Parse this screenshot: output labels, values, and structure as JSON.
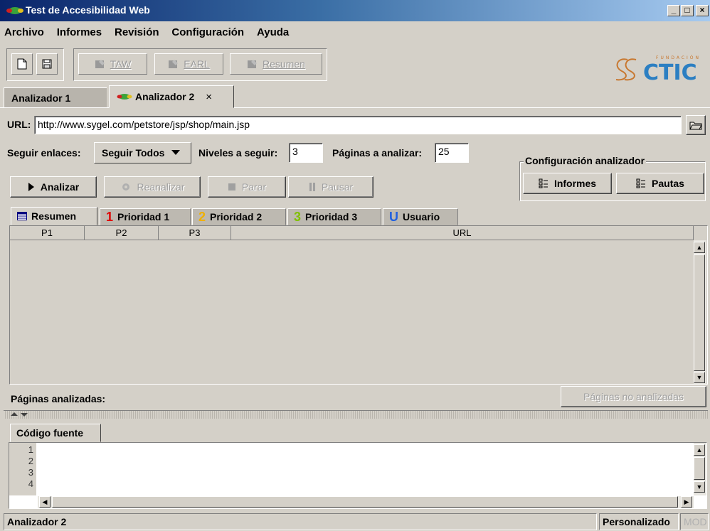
{
  "window": {
    "title": "Test de Accesibilidad Web",
    "controls": {
      "minimize": "_",
      "maximize": "□",
      "close": "×"
    }
  },
  "menu": [
    {
      "label": "Archivo"
    },
    {
      "label": "Informes"
    },
    {
      "label": "Revisión"
    },
    {
      "label": "Configuración"
    },
    {
      "label": "Ayuda"
    }
  ],
  "toolbar": {
    "new_icon": "new-document-icon",
    "save_icon": "floppy-save-icon",
    "buttons": [
      {
        "label": "TAW",
        "icon": "report-icon"
      },
      {
        "label": "EARL",
        "icon": "report-icon"
      },
      {
        "label": "Resumen",
        "icon": "report-icon"
      }
    ]
  },
  "logo": {
    "small_text": "FUNDACIÓN",
    "text": "CTIC",
    "color": "#2c7fc2"
  },
  "tabs": [
    {
      "label": "Analizador 1",
      "active": false
    },
    {
      "label": "Analizador 2",
      "active": true,
      "close": "×"
    }
  ],
  "url": {
    "label": "URL:",
    "value": "http://www.sygel.com/petstore/jsp/shop/main.jsp"
  },
  "options": {
    "follow_label": "Seguir enlaces:",
    "follow_value": "Seguir Todos",
    "levels_label": "Niveles a seguir:",
    "levels_value": "3",
    "pages_label": "Páginas a analizar:",
    "pages_value": "25"
  },
  "analyzer_config": {
    "title": "Configuración analizador",
    "informes_label": "Informes",
    "pautas_label": "Pautas"
  },
  "actions": {
    "analizar": "Analizar",
    "reanalizar": "Reanalizar",
    "parar": "Parar",
    "pausar": "Pausar"
  },
  "result_tabs": [
    {
      "label": "Resumen",
      "badge": "",
      "color": "#000080",
      "active": true
    },
    {
      "label": "Prioridad 1",
      "badge": "1",
      "color": "#e00000",
      "active": false
    },
    {
      "label": "Prioridad 2",
      "badge": "2",
      "color": "#f0b000",
      "active": false
    },
    {
      "label": "Prioridad 3",
      "badge": "3",
      "color": "#80c000",
      "active": false
    },
    {
      "label": "Usuario",
      "badge": "U",
      "color": "#2060e0",
      "active": false
    }
  ],
  "table": {
    "columns": [
      "P1",
      "P2",
      "P3",
      "URL"
    ],
    "rows": []
  },
  "analyzed": {
    "label": "Páginas analizadas:",
    "not_analyzed_button": "Páginas no analizadas"
  },
  "source": {
    "tab_label": "Código fuente",
    "line_numbers": [
      "1",
      "2",
      "3",
      "4"
    ]
  },
  "status": {
    "left": "Analizador 2",
    "mode": "Personalizado",
    "mod": "MOD"
  }
}
